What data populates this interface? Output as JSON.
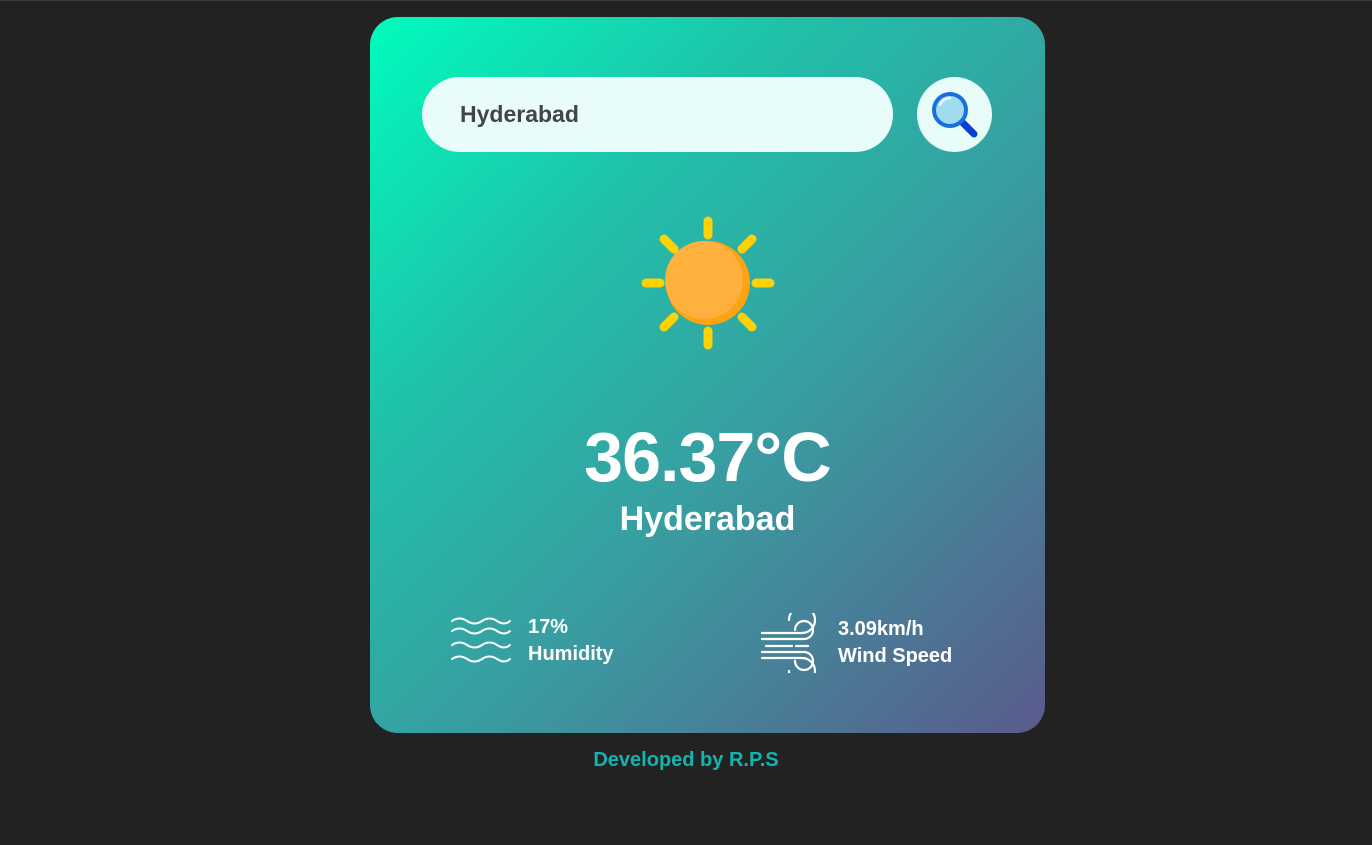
{
  "search": {
    "value": "Hyderabad",
    "button_icon": "search-icon"
  },
  "weather": {
    "icon": "sun-icon",
    "temperature": "36.37°C",
    "city": "Hyderabad"
  },
  "details": {
    "humidity": {
      "icon": "humidity-waves-icon",
      "value": "17%",
      "label": "Humidity"
    },
    "wind": {
      "icon": "wind-icon",
      "value": "3.09km/h",
      "label": "Wind Speed"
    }
  },
  "footer": {
    "text": "Developed by R.P.S"
  },
  "colors": {
    "background": "#222222",
    "card_gradient_start": "#00fcbd",
    "card_gradient_end": "#5a5a8c",
    "sun": "#ffb13d",
    "sun_rays": "#ffd200",
    "footer_text": "#13b3b0"
  }
}
